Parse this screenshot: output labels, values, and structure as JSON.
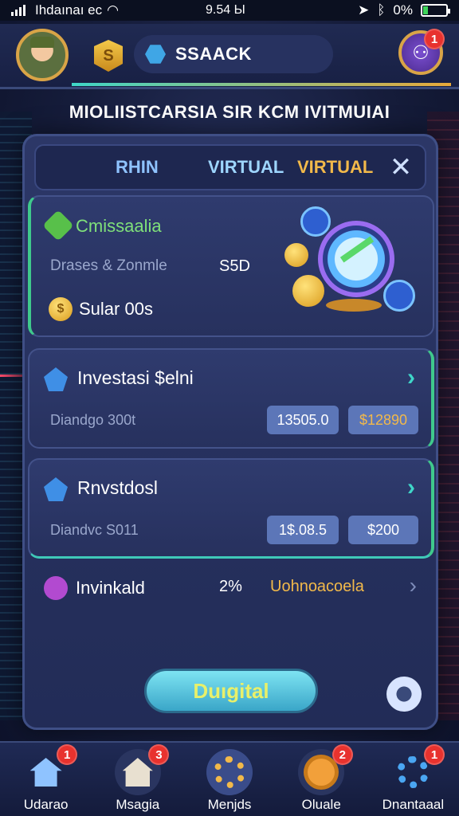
{
  "statusbar": {
    "carrier": "Ihdaınaı ec",
    "time": "9.54 Ы",
    "battery": "0%"
  },
  "header": {
    "search_text": "SSAACK",
    "profile_badge": "1",
    "shield_glyph": "S"
  },
  "page_title": "MIOLIISTCARSIA SIR KCM IVITMUIAI",
  "tabs": [
    {
      "label": "RHIN"
    },
    {
      "label": "VIRTUAL"
    },
    {
      "label": "VIRTUAL"
    }
  ],
  "feature": {
    "title": "Cmissaalia",
    "row_label": "Drases & Zonmle",
    "row_value": "S5D",
    "sub_label": "Sular 00s",
    "coin_glyph": "$"
  },
  "investments": [
    {
      "title": "Investasi $elni",
      "label": "Diandgo 300t",
      "value_a": "13505.0",
      "value_b": "$12890"
    },
    {
      "title": "Rnvstdosl",
      "label": "Diandvc S011",
      "value_a": "1$.08.5",
      "value_b": "$200"
    }
  ],
  "invalid_row": {
    "label": "Invinkald",
    "percent": "2%",
    "status": "Uohnoacoela"
  },
  "action_button": "Duıgital",
  "bottom_nav": [
    {
      "label": "Udarao",
      "badge": "1",
      "icon": "home-icon"
    },
    {
      "label": "Msagia",
      "badge": "3",
      "icon": "house-icon"
    },
    {
      "label": "Menjds",
      "badge": "",
      "icon": "gear-icon"
    },
    {
      "label": "Oluale",
      "badge": "2",
      "icon": "sun-icon"
    },
    {
      "label": "Dnantaaal",
      "badge": "1",
      "icon": "settings-icon"
    }
  ],
  "colors": {
    "accent_teal": "#3fd6c8",
    "accent_gold": "#f2b94a",
    "badge_red": "#e8322e",
    "panel_bg": "#2c3767"
  }
}
